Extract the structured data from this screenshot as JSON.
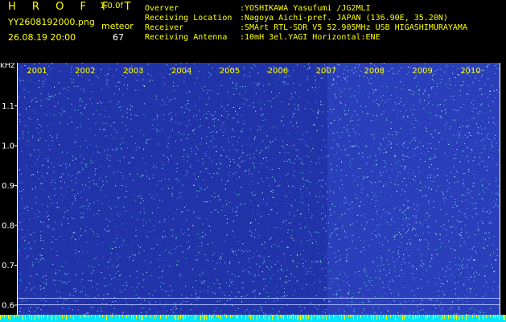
{
  "header": {
    "app_title": "H R O F F T",
    "app_version": "1.0.0f",
    "file_name": "YY2608192000.png",
    "meteor_label": "meteor",
    "date_time": "26.08.19 20:00",
    "meteor_count": "67",
    "info": [
      {
        "label": "Overver",
        "value": ":YOSHIKAWA Yasufumi /JG2MLI"
      },
      {
        "label": "Receiving Location",
        "value": ":Nagoya Aichi-pref. JAPAN (136.90E, 35.20N)"
      },
      {
        "label": "Receiver",
        "value": ":SMArt RTL-SDR V5 52.905MHz USB HIGASHIMURAYAMA"
      },
      {
        "label": "Receiving Antenna",
        "value": ":10mH 3el.YAGI Horizontal:ENE"
      }
    ]
  },
  "axis": {
    "unit": "kHz",
    "y_ticks": [
      "1.1",
      "1.0",
      "0.9",
      "0.8",
      "0.7",
      "0.6"
    ],
    "y_values": [
      1.1,
      1.0,
      0.9,
      0.8,
      0.7,
      0.6
    ],
    "columns": [
      "2001",
      "2002",
      "2003",
      "2004",
      "2005",
      "2006",
      "2007",
      "2008",
      "2009",
      "2010"
    ]
  },
  "colors": {
    "background": "#000000",
    "header_yellow": "#ffff00",
    "header_white": "#ffffff",
    "spectrum_base": "#1c2ea8",
    "spectrum_noise": "#0b1466",
    "speckle": "#7fd8ff",
    "bottom_band": "#00e5ff",
    "bottom_ticks": "#ffff00"
  }
}
